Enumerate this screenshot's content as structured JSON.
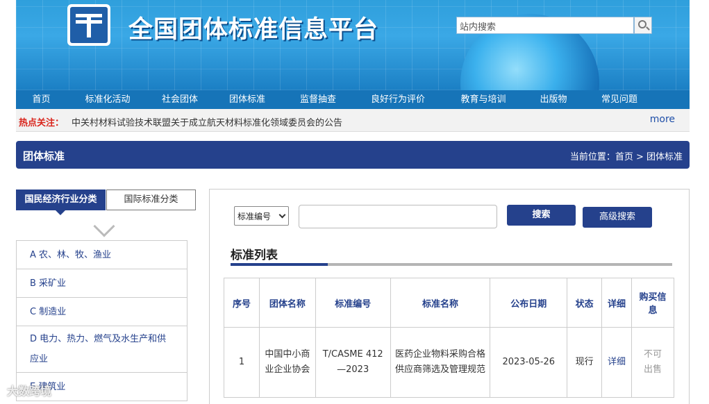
{
  "header": {
    "site_title": "全国团体标准信息平台",
    "search_placeholder": "站内搜索"
  },
  "nav": {
    "items": [
      "首页",
      "标准化活动",
      "社会团体",
      "团体标准",
      "监督抽查",
      "良好行为评价",
      "教育与培训",
      "出版物",
      "常见问题"
    ]
  },
  "hot": {
    "label": "热点关注：",
    "text": "中关村材料试验技术联盟关于成立航天材料标准化领域委员会的公告",
    "more": "more"
  },
  "section": {
    "title": "团体标准",
    "breadcrumb": "当前位置：首页 > 团体标准"
  },
  "left": {
    "tab_active": "国民经济行业分类",
    "tab_other": "国际标准分类",
    "categories": [
      "A 农、林、牧、渔业",
      "B 采矿业",
      "C 制造业",
      "D 电力、热力、燃气及水生产和供应业",
      "E 建筑业"
    ]
  },
  "search": {
    "select_value": "标准编号",
    "search_label": "搜索",
    "advanced_label": "高级搜索"
  },
  "list": {
    "title": "标准列表",
    "headers": [
      "序号",
      "团体名称",
      "标准编号",
      "标准名称",
      "公布日期",
      "状态",
      "详细",
      "购买信息"
    ],
    "rows": [
      [
        "1",
        "中国中小商业企业协会",
        "T/CASME 412—2023",
        "医药企业物料采购合格供应商筛选及管理规范",
        "2023-05-26",
        "现行",
        "详细",
        "不可出售"
      ]
    ]
  },
  "watermark": "大数跨境"
}
